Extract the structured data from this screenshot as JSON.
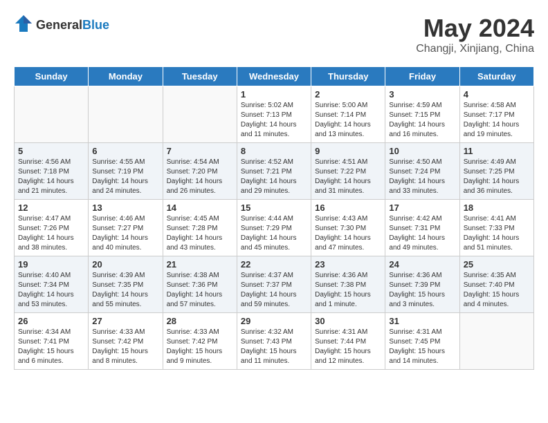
{
  "header": {
    "logo_general": "General",
    "logo_blue": "Blue",
    "title": "May 2024",
    "location": "Changji, Xinjiang, China"
  },
  "days_of_week": [
    "Sunday",
    "Monday",
    "Tuesday",
    "Wednesday",
    "Thursday",
    "Friday",
    "Saturday"
  ],
  "weeks": [
    {
      "row_class": "row-odd",
      "days": [
        {
          "number": "",
          "info": "",
          "empty": true
        },
        {
          "number": "",
          "info": "",
          "empty": true
        },
        {
          "number": "",
          "info": "",
          "empty": true
        },
        {
          "number": "1",
          "info": "Sunrise: 5:02 AM\nSunset: 7:13 PM\nDaylight: 14 hours\nand 11 minutes.",
          "empty": false
        },
        {
          "number": "2",
          "info": "Sunrise: 5:00 AM\nSunset: 7:14 PM\nDaylight: 14 hours\nand 13 minutes.",
          "empty": false
        },
        {
          "number": "3",
          "info": "Sunrise: 4:59 AM\nSunset: 7:15 PM\nDaylight: 14 hours\nand 16 minutes.",
          "empty": false
        },
        {
          "number": "4",
          "info": "Sunrise: 4:58 AM\nSunset: 7:17 PM\nDaylight: 14 hours\nand 19 minutes.",
          "empty": false
        }
      ]
    },
    {
      "row_class": "row-even",
      "days": [
        {
          "number": "5",
          "info": "Sunrise: 4:56 AM\nSunset: 7:18 PM\nDaylight: 14 hours\nand 21 minutes.",
          "empty": false
        },
        {
          "number": "6",
          "info": "Sunrise: 4:55 AM\nSunset: 7:19 PM\nDaylight: 14 hours\nand 24 minutes.",
          "empty": false
        },
        {
          "number": "7",
          "info": "Sunrise: 4:54 AM\nSunset: 7:20 PM\nDaylight: 14 hours\nand 26 minutes.",
          "empty": false
        },
        {
          "number": "8",
          "info": "Sunrise: 4:52 AM\nSunset: 7:21 PM\nDaylight: 14 hours\nand 29 minutes.",
          "empty": false
        },
        {
          "number": "9",
          "info": "Sunrise: 4:51 AM\nSunset: 7:22 PM\nDaylight: 14 hours\nand 31 minutes.",
          "empty": false
        },
        {
          "number": "10",
          "info": "Sunrise: 4:50 AM\nSunset: 7:24 PM\nDaylight: 14 hours\nand 33 minutes.",
          "empty": false
        },
        {
          "number": "11",
          "info": "Sunrise: 4:49 AM\nSunset: 7:25 PM\nDaylight: 14 hours\nand 36 minutes.",
          "empty": false
        }
      ]
    },
    {
      "row_class": "row-odd",
      "days": [
        {
          "number": "12",
          "info": "Sunrise: 4:47 AM\nSunset: 7:26 PM\nDaylight: 14 hours\nand 38 minutes.",
          "empty": false
        },
        {
          "number": "13",
          "info": "Sunrise: 4:46 AM\nSunset: 7:27 PM\nDaylight: 14 hours\nand 40 minutes.",
          "empty": false
        },
        {
          "number": "14",
          "info": "Sunrise: 4:45 AM\nSunset: 7:28 PM\nDaylight: 14 hours\nand 43 minutes.",
          "empty": false
        },
        {
          "number": "15",
          "info": "Sunrise: 4:44 AM\nSunset: 7:29 PM\nDaylight: 14 hours\nand 45 minutes.",
          "empty": false
        },
        {
          "number": "16",
          "info": "Sunrise: 4:43 AM\nSunset: 7:30 PM\nDaylight: 14 hours\nand 47 minutes.",
          "empty": false
        },
        {
          "number": "17",
          "info": "Sunrise: 4:42 AM\nSunset: 7:31 PM\nDaylight: 14 hours\nand 49 minutes.",
          "empty": false
        },
        {
          "number": "18",
          "info": "Sunrise: 4:41 AM\nSunset: 7:33 PM\nDaylight: 14 hours\nand 51 minutes.",
          "empty": false
        }
      ]
    },
    {
      "row_class": "row-even",
      "days": [
        {
          "number": "19",
          "info": "Sunrise: 4:40 AM\nSunset: 7:34 PM\nDaylight: 14 hours\nand 53 minutes.",
          "empty": false
        },
        {
          "number": "20",
          "info": "Sunrise: 4:39 AM\nSunset: 7:35 PM\nDaylight: 14 hours\nand 55 minutes.",
          "empty": false
        },
        {
          "number": "21",
          "info": "Sunrise: 4:38 AM\nSunset: 7:36 PM\nDaylight: 14 hours\nand 57 minutes.",
          "empty": false
        },
        {
          "number": "22",
          "info": "Sunrise: 4:37 AM\nSunset: 7:37 PM\nDaylight: 14 hours\nand 59 minutes.",
          "empty": false
        },
        {
          "number": "23",
          "info": "Sunrise: 4:36 AM\nSunset: 7:38 PM\nDaylight: 15 hours\nand 1 minute.",
          "empty": false
        },
        {
          "number": "24",
          "info": "Sunrise: 4:36 AM\nSunset: 7:39 PM\nDaylight: 15 hours\nand 3 minutes.",
          "empty": false
        },
        {
          "number": "25",
          "info": "Sunrise: 4:35 AM\nSunset: 7:40 PM\nDaylight: 15 hours\nand 4 minutes.",
          "empty": false
        }
      ]
    },
    {
      "row_class": "row-odd",
      "days": [
        {
          "number": "26",
          "info": "Sunrise: 4:34 AM\nSunset: 7:41 PM\nDaylight: 15 hours\nand 6 minutes.",
          "empty": false
        },
        {
          "number": "27",
          "info": "Sunrise: 4:33 AM\nSunset: 7:42 PM\nDaylight: 15 hours\nand 8 minutes.",
          "empty": false
        },
        {
          "number": "28",
          "info": "Sunrise: 4:33 AM\nSunset: 7:42 PM\nDaylight: 15 hours\nand 9 minutes.",
          "empty": false
        },
        {
          "number": "29",
          "info": "Sunrise: 4:32 AM\nSunset: 7:43 PM\nDaylight: 15 hours\nand 11 minutes.",
          "empty": false
        },
        {
          "number": "30",
          "info": "Sunrise: 4:31 AM\nSunset: 7:44 PM\nDaylight: 15 hours\nand 12 minutes.",
          "empty": false
        },
        {
          "number": "31",
          "info": "Sunrise: 4:31 AM\nSunset: 7:45 PM\nDaylight: 15 hours\nand 14 minutes.",
          "empty": false
        },
        {
          "number": "",
          "info": "",
          "empty": true
        }
      ]
    }
  ]
}
